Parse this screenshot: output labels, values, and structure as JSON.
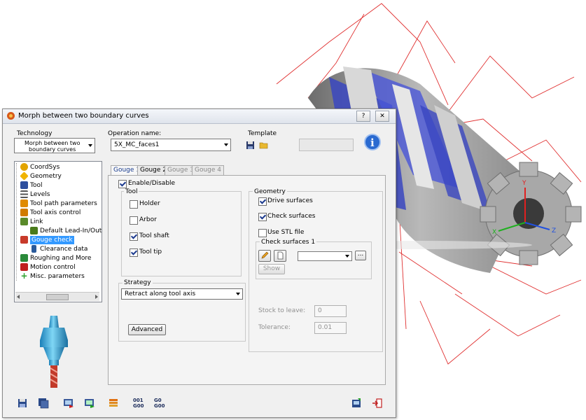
{
  "window": {
    "title": "Morph between two boundary curves",
    "help_btn": "?",
    "close_btn": "✕"
  },
  "technology": {
    "label": "Technology",
    "value_line1": "Morph between two",
    "value_line2": "boundary curves"
  },
  "operation": {
    "label": "Operation name:",
    "value": "5X_MC_faces1"
  },
  "template": {
    "label": "Template"
  },
  "tree": {
    "items": [
      {
        "label": "CoordSys",
        "icon": "coordsys-icon",
        "color": "#e2a400"
      },
      {
        "label": "Geometry",
        "icon": "geometry-icon",
        "color": "#f0b400"
      },
      {
        "label": "Tool",
        "icon": "tool-icon",
        "color": "#2d4f9e"
      },
      {
        "label": "Levels",
        "icon": "levels-icon",
        "color": "#555555"
      },
      {
        "label": "Tool path parameters",
        "icon": "toolpath-icon",
        "color": "#e08a00"
      },
      {
        "label": "Tool axis control",
        "icon": "axis-icon",
        "color": "#d07a00"
      },
      {
        "label": "Link",
        "icon": "link-icon",
        "color": "#5a8a2a"
      },
      {
        "label": "Default Lead-In/Out",
        "icon": "leadin-icon",
        "color": "#4a7a1a"
      },
      {
        "label": "Gouge check",
        "icon": "gouge-icon",
        "color": "#c83a2a"
      },
      {
        "label": "Clearance data",
        "icon": "clearance-icon",
        "color": "#2a5a9a"
      },
      {
        "label": "Roughing and More",
        "icon": "roughing-icon",
        "color": "#2a8a3a"
      },
      {
        "label": "Motion control",
        "icon": "motion-icon",
        "color": "#c02020"
      },
      {
        "label": "Misc. parameters",
        "icon": "misc-icon",
        "color": "#2ca02c"
      }
    ]
  },
  "tabs": [
    {
      "label": "Gouge 1"
    },
    {
      "label": "Gouge 2"
    },
    {
      "label": "Gouge 3"
    },
    {
      "label": "Gouge 4"
    }
  ],
  "gouge": {
    "enable_label": "Enable/Disable",
    "tool_group": "Tool",
    "holder": "Holder",
    "arbor": "Arbor",
    "tool_shaft": "Tool shaft",
    "tool_tip": "Tool tip",
    "geometry_group": "Geometry",
    "drive_surfaces": "Drive surfaces",
    "check_surfaces": "Check surfaces",
    "use_stl": "Use STL file",
    "check_surfaces_1": "Check surfaces 1",
    "show_btn": "Show",
    "strategy_group": "Strategy",
    "strategy_value": "Retract along tool axis",
    "advanced_btn": "Advanced",
    "stock_label": "Stock to leave:",
    "stock_value": "0",
    "tolerance_label": "Tolerance:",
    "tolerance_value": "0.01"
  },
  "toolbar": {
    "code1_top": "001",
    "code1_bottom": "G00",
    "code2_top": "G0",
    "code2_bottom": "G00"
  }
}
